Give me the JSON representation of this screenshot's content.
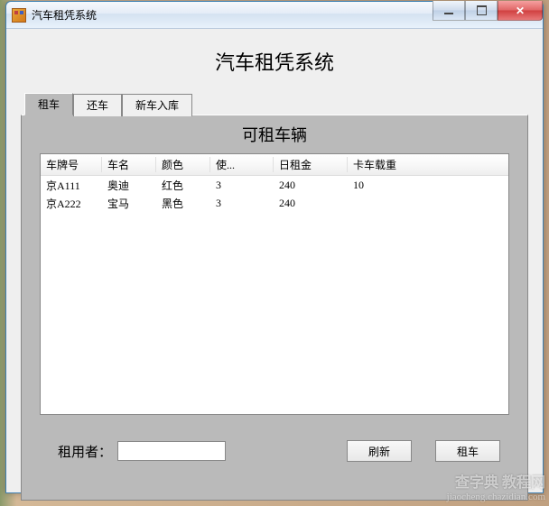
{
  "window": {
    "title": "汽车租凭系统"
  },
  "main_title": "汽车租凭系统",
  "tabs": [
    {
      "label": "租车",
      "active": true
    },
    {
      "label": "还车",
      "active": false
    },
    {
      "label": "新车入库",
      "active": false
    }
  ],
  "panel": {
    "title": "可租车辆",
    "columns": [
      "车牌号",
      "车名",
      "颜色",
      "使...",
      "日租金",
      "卡车载重"
    ],
    "rows": [
      {
        "plate": "京A111",
        "name": "奥迪",
        "color": "红色",
        "usage": "3",
        "daily": "240",
        "load": "10"
      },
      {
        "plate": "京A222",
        "name": "宝马",
        "color": "黑色",
        "usage": "3",
        "daily": "240",
        "load": ""
      }
    ],
    "renter_label": "租用者：",
    "renter_value": "",
    "refresh_label": "刷新",
    "rent_label": "租车"
  },
  "watermark": {
    "main": "查字典 教程网",
    "sub": "jiaocheng.chazidian.com"
  }
}
